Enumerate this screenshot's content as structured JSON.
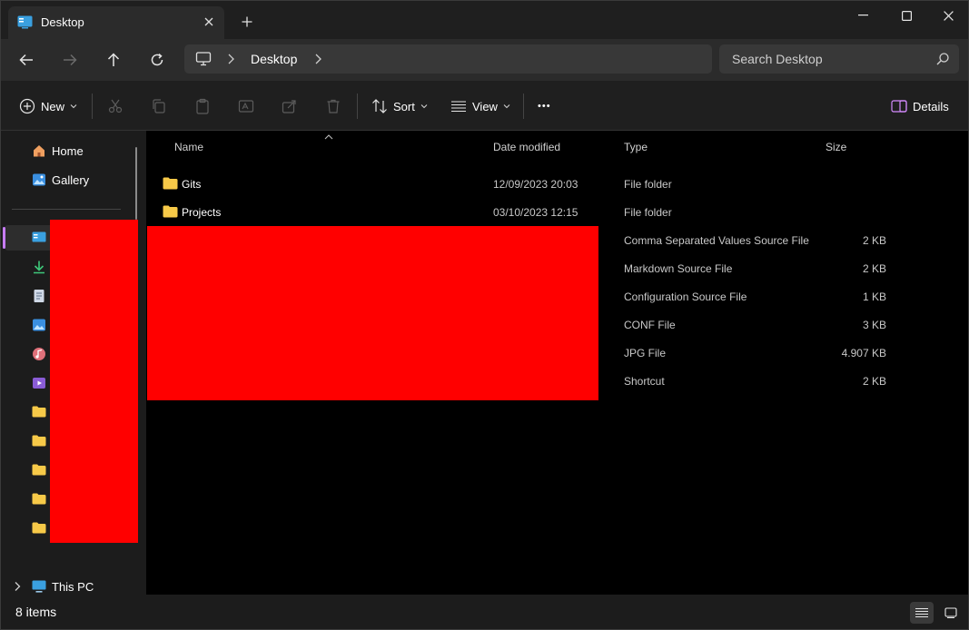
{
  "window": {
    "tab_title": "Desktop",
    "minimize_glyph": "—",
    "maximize_glyph": "☐",
    "close_glyph": "✕"
  },
  "address": {
    "crumb": "Desktop",
    "search_placeholder": "Search Desktop"
  },
  "toolbar": {
    "new_label": "New",
    "sort_label": "Sort",
    "view_label": "View",
    "more_label": "•••",
    "details_label": "Details"
  },
  "sidebar": {
    "home": "Home",
    "gallery": "Gallery",
    "this_pc": "This PC"
  },
  "columns": {
    "name": "Name",
    "date": "Date modified",
    "type": "Type",
    "size": "Size"
  },
  "files": [
    {
      "name": "Gits",
      "date": "12/09/2023 20:03",
      "type": "File folder",
      "size": ""
    },
    {
      "name": "Projects",
      "date": "03/10/2023 12:15",
      "type": "File folder",
      "size": ""
    },
    {
      "name": "",
      "date": "",
      "type": "Comma Separated Values Source File",
      "size": "2 KB"
    },
    {
      "name": "",
      "date": "",
      "type": "Markdown Source File",
      "size": "2 KB"
    },
    {
      "name": "",
      "date": "",
      "type": "Configuration Source File",
      "size": "1 KB"
    },
    {
      "name": "",
      "date": "",
      "type": "CONF File",
      "size": "3 KB"
    },
    {
      "name": "",
      "date": "",
      "type": "JPG File",
      "size": "4.907 KB"
    },
    {
      "name": "",
      "date": "",
      "type": "Shortcut",
      "size": "2 KB"
    }
  ],
  "status": {
    "item_count": "8 items"
  },
  "colors": {
    "accent": "#c77dff",
    "folder": "#f7c948",
    "redaction": "#ff0000"
  }
}
